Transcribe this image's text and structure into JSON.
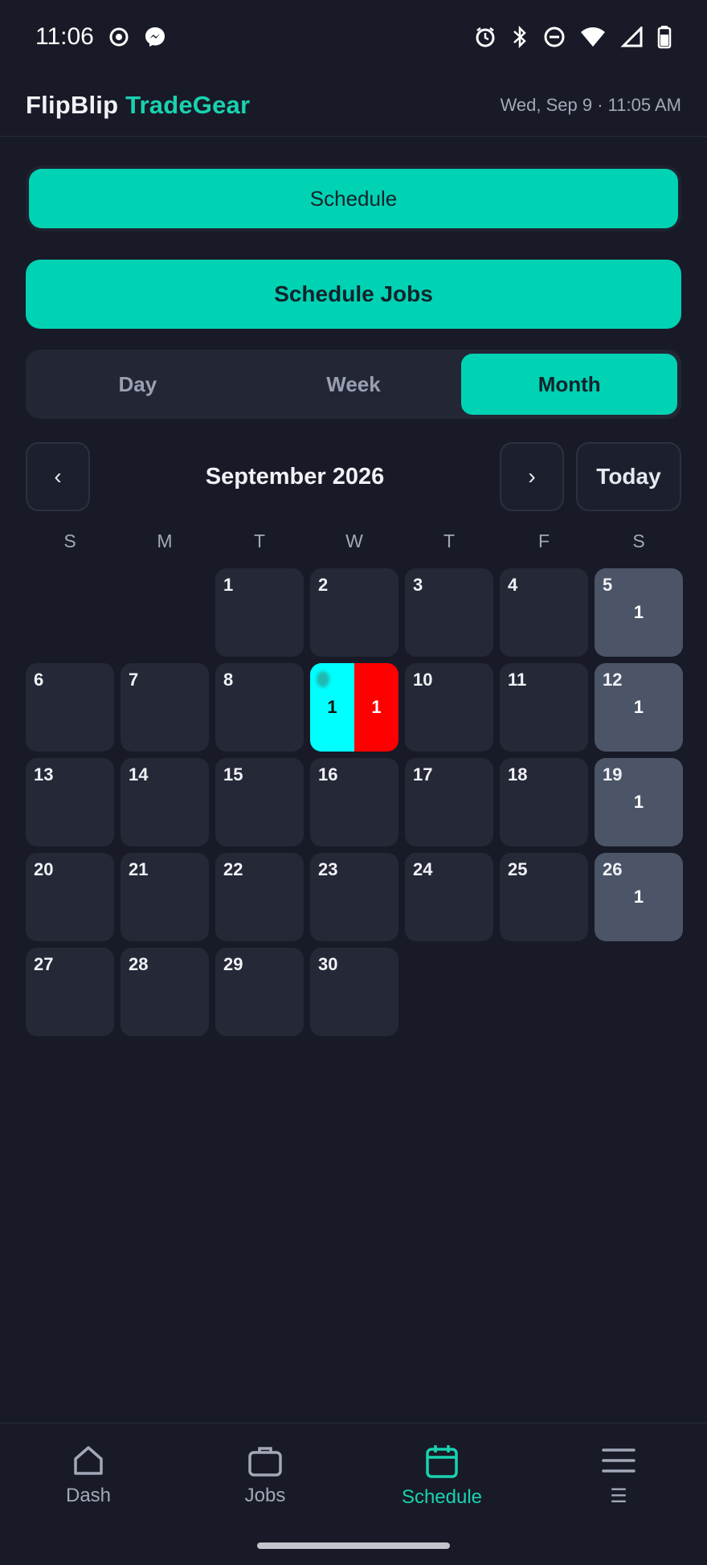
{
  "status_bar": {
    "time": "11:06"
  },
  "header": {
    "brand_1": "FlipBlip",
    "brand_2": "TradeGear",
    "datetime": "Wed, Sep 9 · 11:05 AM"
  },
  "buttons": {
    "schedule": "Schedule",
    "schedule_jobs": "Schedule Jobs"
  },
  "views": [
    "Day",
    "Week",
    "Month"
  ],
  "active_view": "Month",
  "month_nav": {
    "prev": "‹",
    "title": "September 2026",
    "next": "›",
    "today": "Today"
  },
  "weekdays": [
    "S",
    "M",
    "T",
    "W",
    "T",
    "F",
    "S"
  ],
  "calendar": {
    "leading_blanks": 2,
    "days": [
      {
        "d": "1"
      },
      {
        "d": "2"
      },
      {
        "d": "3"
      },
      {
        "d": "4"
      },
      {
        "d": "5",
        "count": "1",
        "weekend": true
      },
      {
        "d": "6"
      },
      {
        "d": "7"
      },
      {
        "d": "8"
      },
      {
        "d": "9",
        "split": [
          "1",
          "1"
        ]
      },
      {
        "d": "10"
      },
      {
        "d": "11"
      },
      {
        "d": "12",
        "count": "1",
        "weekend": true
      },
      {
        "d": "13"
      },
      {
        "d": "14"
      },
      {
        "d": "15"
      },
      {
        "d": "16"
      },
      {
        "d": "17"
      },
      {
        "d": "18"
      },
      {
        "d": "19",
        "count": "1",
        "weekend": true
      },
      {
        "d": "20"
      },
      {
        "d": "21"
      },
      {
        "d": "22"
      },
      {
        "d": "23"
      },
      {
        "d": "24"
      },
      {
        "d": "25"
      },
      {
        "d": "26",
        "count": "1",
        "weekend": true
      },
      {
        "d": "27"
      },
      {
        "d": "28"
      },
      {
        "d": "29"
      },
      {
        "d": "30"
      }
    ]
  },
  "bottom_nav": [
    {
      "label": "Dash",
      "icon": "home-icon"
    },
    {
      "label": "Jobs",
      "icon": "briefcase-icon"
    },
    {
      "label": "Schedule",
      "icon": "calendar-icon",
      "active": true
    },
    {
      "label": "☰",
      "icon": "menu-icon"
    }
  ],
  "colors": {
    "accent": "#00d2b4",
    "background": "#181a27",
    "cell": "#252837",
    "weekend_cell": "#4b5567"
  }
}
